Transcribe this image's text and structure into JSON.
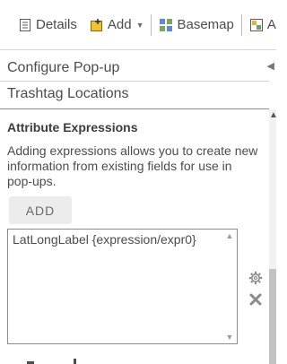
{
  "toolbar": {
    "details_label": "Details",
    "add_label": "Add",
    "basemap_label": "Basemap",
    "analysis_label": "A"
  },
  "panel": {
    "title": "Configure Pop-up",
    "layer_name": "Trashtag Locations"
  },
  "expressions": {
    "section_title": "Attribute Expressions",
    "description": "Adding expressions allows you to create new information from existing fields for use in pop-ups.",
    "add_button": "ADD",
    "items": [
      "LatLongLabel {expression/expr0}"
    ]
  },
  "colors": {
    "text": "#4c4c4c",
    "border": "#d6d6d6",
    "button_bg": "#ececec"
  },
  "icons": [
    "details-icon",
    "add-icon",
    "basemap-icon",
    "analysis-icon",
    "collapse-arrow-icon",
    "gear-icon",
    "close-icon"
  ]
}
